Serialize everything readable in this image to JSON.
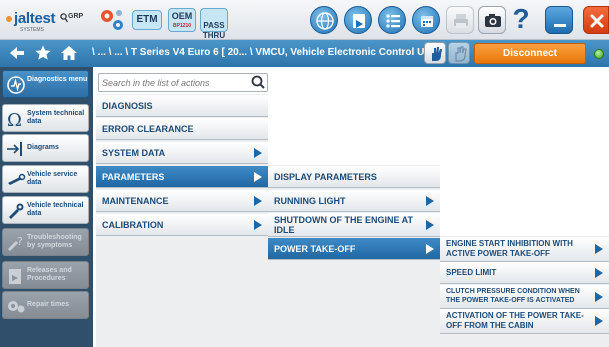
{
  "app": {
    "logo_text": "jaltest",
    "logo_sub": "SYSTEMS",
    "grp_label": "GRP",
    "etm_label": "ETM",
    "oem_label": "OEM",
    "oem_sub": "BP1210",
    "pass_label": "PASS\nTHRU",
    "help_label": "?"
  },
  "navbar": {
    "path": "\\ ... \\ ... \\ T Series V4 Euro 6 [ 20... \\ VMCU, Vehicle Electronic Control Unit",
    "disconnect_label": "Disconnect"
  },
  "sidebar": {
    "items": [
      {
        "label": "Diagnostics menu",
        "icon": "diagnostics-icon",
        "state": "active"
      },
      {
        "label": "System technical data",
        "icon": "omega-icon",
        "state": "normal"
      },
      {
        "label": "Diagrams",
        "icon": "diagram-icon",
        "state": "normal"
      },
      {
        "label": "Vehicle service data",
        "icon": "wrench-icon",
        "state": "normal"
      },
      {
        "label": "Vehicle technical data",
        "icon": "tools-icon",
        "state": "normal"
      },
      {
        "label": "Troubleshooting by symptoms",
        "icon": "troubleshoot-icon",
        "state": "disabled"
      },
      {
        "label": "Releases and Procedures",
        "icon": "release-icon",
        "state": "disabled"
      },
      {
        "label": "Repair times",
        "icon": "repair-icon",
        "state": "disabled"
      }
    ]
  },
  "search": {
    "placeholder": "Search in the list of actions"
  },
  "menu": {
    "level1": [
      {
        "label": "DIAGNOSIS"
      },
      {
        "label": "ERROR CLEARANCE"
      },
      {
        "label": "SYSTEM DATA"
      },
      {
        "label": "PARAMETERS"
      },
      {
        "label": "MAINTENANCE"
      },
      {
        "label": "CALIBRATION"
      }
    ],
    "level2": [
      {
        "label": "DISPLAY PARAMETERS"
      },
      {
        "label": "RUNNING LIGHT"
      },
      {
        "label": "SHUTDOWN OF THE ENGINE AT IDLE"
      },
      {
        "label": "POWER TAKE-OFF"
      }
    ],
    "level3": [
      {
        "label": "ENGINE START INHIBITION WITH ACTIVE POWER TAKE-OFF"
      },
      {
        "label": "SPEED LIMIT"
      },
      {
        "label": "CLUTCH PRESSURE CONDITION WHEN THE POWER TAKE-OFF IS ACTIVATED"
      },
      {
        "label": "ACTIVATION OF THE POWER TAKE-OFF FROM THE CABIN"
      }
    ]
  },
  "colors": {
    "accent_blue": "#1f67a4",
    "disconnect_orange": "#f08a1c",
    "sidebar_bg": "#2f4f6b",
    "close_red": "#d43b10"
  }
}
